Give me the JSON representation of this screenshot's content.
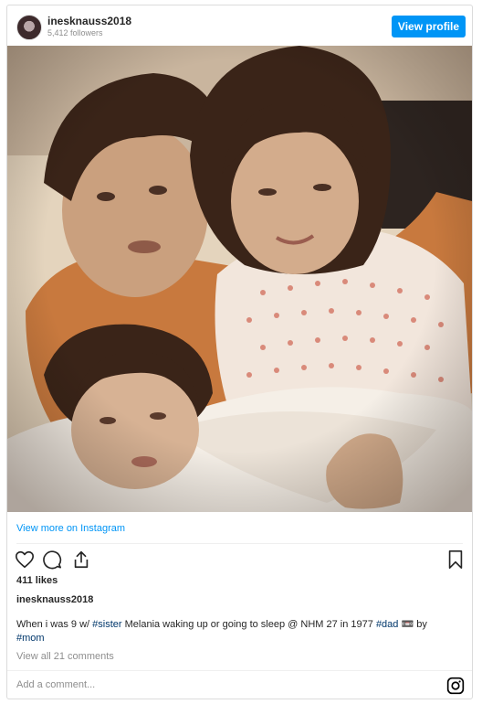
{
  "header": {
    "username": "inesknauss2018",
    "followers": "5,412 followers",
    "view_profile_label": "View profile",
    "avatar_icon": "profile-avatar"
  },
  "photo": {
    "alt": "vintage family photo"
  },
  "view_more_label": "View more on Instagram",
  "actions": {
    "like_icon": "heart-icon",
    "comment_icon": "comment-icon",
    "share_icon": "share-icon",
    "save_icon": "bookmark-icon"
  },
  "likes": "411 likes",
  "owner": "inesknauss2018",
  "caption": {
    "t1": "When i was 9 w/ ",
    "tag1": "#sister",
    "t2": " Melania waking up or going to sleep @ NHM 27 in 1977 ",
    "tag2": "#dad",
    "t3": " 📼 by ",
    "tag3": "#mom"
  },
  "view_comments": "View all 21 comments",
  "add_comment_placeholder": "Add a comment...",
  "colors": {
    "accent": "#0095f6",
    "text": "#262626",
    "muted": "#8e8e8e",
    "hashtag": "#00376b"
  }
}
